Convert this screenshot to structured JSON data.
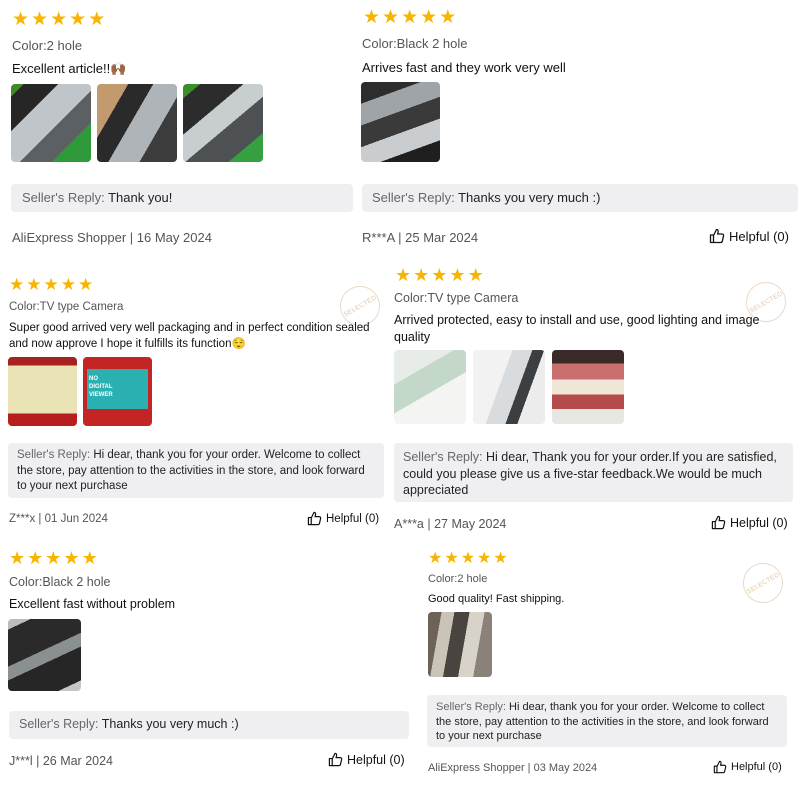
{
  "reviews": [
    {
      "color": "Color:2 hole",
      "text": "Excellent article!!🙌🏾",
      "reply_who": "Seller's Reply:",
      "reply": "Thank you!",
      "meta": "AliExpress Shopper | 16 May 2024"
    },
    {
      "color": "Color:Black 2 hole",
      "text": "Arrives fast and they work very well",
      "reply_who": "Seller's Reply:",
      "reply": "Thanks you very much :)",
      "meta": "R***A | 25 Mar 2024",
      "helpful": "Helpful (0)"
    },
    {
      "color": "Color:TV type Camera",
      "text": "Super good arrived very well packaging and in perfect condition sealed and now approve I hope it fulfills its function😌",
      "reply_who": "Seller's Reply:",
      "reply": "Hi dear, thank you for your order. Welcome to collect the store, pay attention to the activities in the store, and look forward to your next purchase",
      "meta": "Z***x | 01 Jun 2024",
      "helpful": "Helpful (0)",
      "stamp": "SELECTED",
      "thumb_caption": "NO DIGITAL VIEWER"
    },
    {
      "color": "Color:TV type Camera",
      "text": "Arrived protected, easy to install and use, good lighting and image quality",
      "reply_who": "Seller's Reply:",
      "reply": "Hi dear, Thank you for your order.If you are satisfied, could you please give us a five-star feedback.We would be much appreciated",
      "meta": "A***a | 27 May 2024",
      "helpful": "Helpful (0)",
      "stamp": "SELECTED"
    },
    {
      "color": "Color:Black 2 hole",
      "text": "Excellent fast without problem",
      "reply_who": "Seller's Reply:",
      "reply": "Thanks you very much :)",
      "meta": "J***l | 26 Mar 2024",
      "helpful": "Helpful (0)"
    },
    {
      "color": "Color:2 hole",
      "text": "Good quality! Fast shipping.",
      "reply_who": "Seller's Reply:",
      "reply": "Hi dear, thank you for your order. Welcome to collect the store, pay attention to the activities in the store, and look forward to your next purchase",
      "meta": "AliExpress Shopper | 03 May 2024",
      "helpful": "Helpful (0)",
      "stamp": "SELECTED"
    }
  ],
  "rating": {
    "stars": 5,
    "star_color": "#f7b500"
  },
  "icons": {
    "star": "star-icon",
    "helpful": "thumbs-up-icon"
  }
}
